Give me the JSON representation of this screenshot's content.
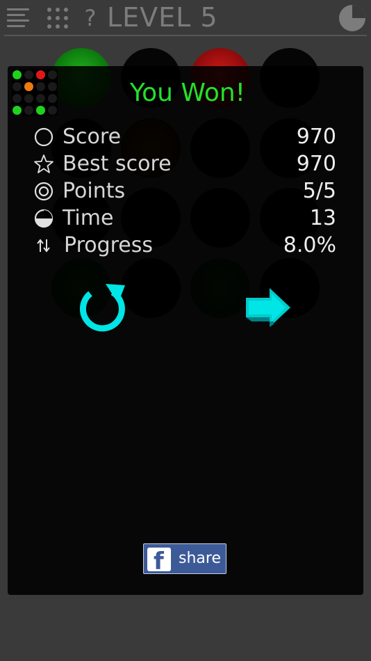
{
  "header": {
    "help_symbol": "?",
    "level_title": "LEVEL 5"
  },
  "result": {
    "headline": "You Won!",
    "stats": [
      {
        "icon": "score-icon",
        "label": "Score",
        "value": "970"
      },
      {
        "icon": "star-icon",
        "label": "Best score",
        "value": "970"
      },
      {
        "icon": "target-icon",
        "label": "Points",
        "value": "5/5"
      },
      {
        "icon": "clock-icon",
        "label": "Time",
        "value": "13"
      },
      {
        "icon": "up-down-arrows-icon",
        "label": "Progress",
        "value": "8.0%"
      }
    ],
    "timer_progress": 0.25
  },
  "share": {
    "fb_letter": "f",
    "label": "share"
  },
  "colors": {
    "accent": "#00E5E5",
    "headline": "#22E22A",
    "facebook": "#3D5A98",
    "background": "#3A3A3A"
  }
}
